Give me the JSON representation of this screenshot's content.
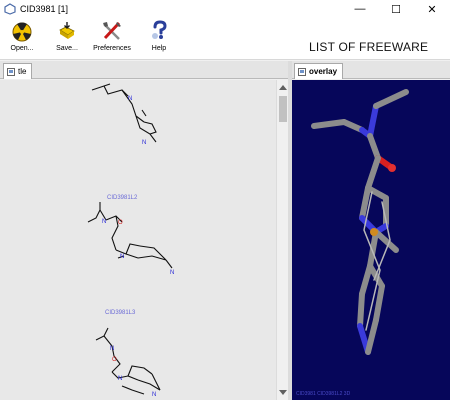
{
  "window": {
    "title": "CID3981 [1]",
    "controls": {
      "minimize": "—",
      "maximize": "☐",
      "close": "✕"
    }
  },
  "toolbar": {
    "open_label": "Open...",
    "save_label": "Save...",
    "preferences_label": "Preferences",
    "help_label": "Help"
  },
  "banner": "LIST OF FREEWARE",
  "left_tab": {
    "label": "tle"
  },
  "right_tab": {
    "label": "overlay"
  },
  "molecules": [
    {
      "caption": ""
    },
    {
      "caption": "CID3981L2"
    },
    {
      "caption": "CID3981L3"
    }
  ],
  "viewer": {
    "caption": "CID3981 CID3981L2 3D"
  },
  "colors": {
    "viewer_bg": "#06065a",
    "carbon": "#8c8c8c",
    "nitrogen": "#3a3adc",
    "oxygen": "#d92020",
    "accent_blue": "#6a6ad6"
  }
}
